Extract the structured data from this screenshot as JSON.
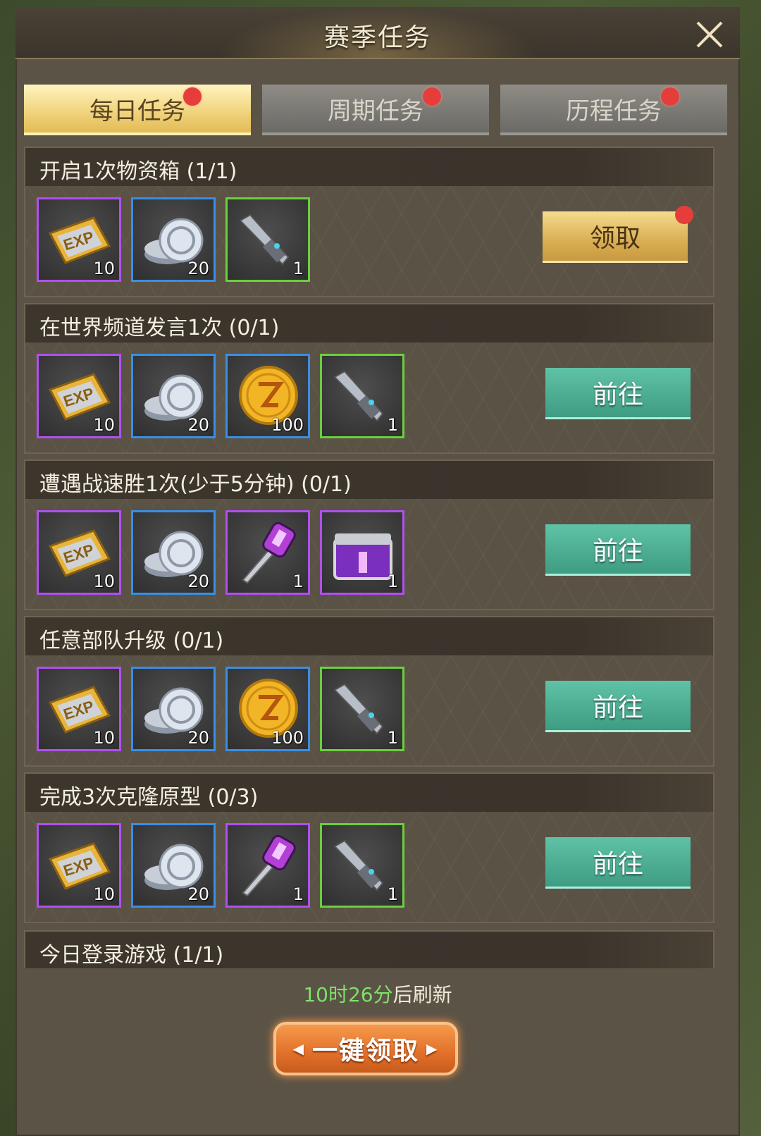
{
  "title": "赛季任务",
  "tabs": [
    {
      "label": "每日任务",
      "active": true,
      "badge": true
    },
    {
      "label": "周期任务",
      "active": false,
      "badge": true
    },
    {
      "label": "历程任务",
      "active": false,
      "badge": true
    }
  ],
  "tasks": [
    {
      "title": "开启1次物资箱 (1/1)",
      "button": "领取",
      "button_type": "claim",
      "badge": true,
      "rewards": [
        {
          "icon": "exp-ticket-icon",
          "count": "10",
          "rarity": "purple"
        },
        {
          "icon": "silver-coins-icon",
          "count": "20",
          "rarity": "blue"
        },
        {
          "icon": "knife-key-icon",
          "count": "1",
          "rarity": "green"
        }
      ]
    },
    {
      "title": "在世界频道发言1次 (0/1)",
      "button": "前往",
      "button_type": "go",
      "badge": false,
      "rewards": [
        {
          "icon": "exp-ticket-icon",
          "count": "10",
          "rarity": "purple"
        },
        {
          "icon": "silver-coins-icon",
          "count": "20",
          "rarity": "blue"
        },
        {
          "icon": "gold-coin-icon",
          "count": "100",
          "rarity": "blue"
        },
        {
          "icon": "knife-key-icon",
          "count": "1",
          "rarity": "green"
        }
      ]
    },
    {
      "title": "遭遇战速胜1次(少于5分钟) (0/1)",
      "button": "前往",
      "button_type": "go",
      "badge": false,
      "rewards": [
        {
          "icon": "exp-ticket-icon",
          "count": "10",
          "rarity": "purple"
        },
        {
          "icon": "silver-coins-icon",
          "count": "20",
          "rarity": "blue"
        },
        {
          "icon": "purple-key-icon",
          "count": "1",
          "rarity": "purple"
        },
        {
          "icon": "purple-crate-icon",
          "count": "1",
          "rarity": "purple"
        }
      ]
    },
    {
      "title": "任意部队升级 (0/1)",
      "button": "前往",
      "button_type": "go",
      "badge": false,
      "rewards": [
        {
          "icon": "exp-ticket-icon",
          "count": "10",
          "rarity": "purple"
        },
        {
          "icon": "silver-coins-icon",
          "count": "20",
          "rarity": "blue"
        },
        {
          "icon": "gold-coin-icon",
          "count": "100",
          "rarity": "blue"
        },
        {
          "icon": "knife-key-icon",
          "count": "1",
          "rarity": "green"
        }
      ]
    },
    {
      "title": "完成3次克隆原型 (0/3)",
      "button": "前往",
      "button_type": "go",
      "badge": false,
      "rewards": [
        {
          "icon": "exp-ticket-icon",
          "count": "10",
          "rarity": "purple"
        },
        {
          "icon": "silver-coins-icon",
          "count": "20",
          "rarity": "blue"
        },
        {
          "icon": "purple-key-icon",
          "count": "1",
          "rarity": "purple"
        },
        {
          "icon": "knife-key-icon",
          "count": "1",
          "rarity": "green"
        }
      ]
    }
  ],
  "last_task_title": "今日登录游戏 (1/1)",
  "refresh_time": "10时26分",
  "refresh_suffix": "后刷新",
  "claim_all_label": "一键领取",
  "colors": {
    "active_tab": "#f0d27a",
    "go_button": "#4fae94",
    "claim_button": "#d9ae54",
    "claim_all": "#e2702a",
    "badge": "#e53e3a",
    "refresh_time": "#7fe06a"
  }
}
